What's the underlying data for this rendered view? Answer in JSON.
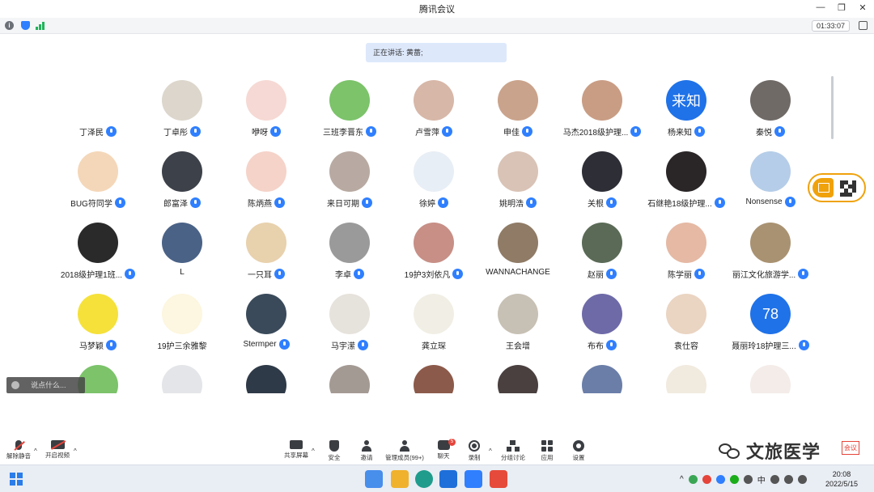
{
  "window": {
    "title": "腾讯会议",
    "timer": "01:33:07"
  },
  "speaking": {
    "label": "正在讲话: 黄蔷;"
  },
  "participants": [
    {
      "name": "丁泽民",
      "bg": "#ffffff",
      "fg": "#222222",
      "icon": "cartoon-face-avatar"
    },
    {
      "name": "丁卓彤",
      "bg": "#dcd6cc",
      "icon": "dog-avatar"
    },
    {
      "name": "咿呀",
      "bg": "#f6d9d4",
      "icon": "cartoon-girl-avatar"
    },
    {
      "name": "三班李晋东",
      "bg": "#7cc36a",
      "icon": "frog-avatar"
    },
    {
      "name": "卢雪萍",
      "bg": "#d7b7a8",
      "icon": "photo-avatar"
    },
    {
      "name": "申佳",
      "bg": "#caa38c",
      "icon": "photo-avatar"
    },
    {
      "name": "马杰2018级护理...",
      "bg": "#c99d84",
      "icon": "photo-avatar"
    },
    {
      "name": "杨来知",
      "bg": "#1f72e8",
      "text": "来知"
    },
    {
      "name": "秦悦",
      "bg": "#6f6a66",
      "icon": "photo-avatar"
    },
    {
      "name": "BUG符同学",
      "bg": "#f4d7b9",
      "icon": "anime-avatar"
    },
    {
      "name": "郎富泽",
      "bg": "#3d4149",
      "icon": "photo-avatar"
    },
    {
      "name": "陈炳燕",
      "bg": "#f5d3c9",
      "icon": "cartoon-avatar"
    },
    {
      "name": "来日可期",
      "bg": "#b8aaa2",
      "icon": "photo-avatar"
    },
    {
      "name": "徐婷",
      "bg": "#e8eef5",
      "icon": "balloon-avatar"
    },
    {
      "name": "姚明浩",
      "bg": "#d9c3b6",
      "icon": "photo-avatar"
    },
    {
      "name": "关根",
      "bg": "#2d2e36",
      "icon": "photo-avatar"
    },
    {
      "name": "石继艳18级护理...",
      "bg": "#2a2526",
      "icon": "photo-avatar"
    },
    {
      "name": "Nonsense",
      "bg": "#b5cde8",
      "icon": "anime-avatar"
    },
    {
      "name": "2018级护理1班...",
      "bg": "#2a2a2a",
      "icon": "photo-avatar"
    },
    {
      "name": "L",
      "bg": "#4a6286",
      "icon": "photo-avatar",
      "nomic": true
    },
    {
      "name": "一只耳",
      "bg": "#e8d1ad",
      "icon": "dog-avatar"
    },
    {
      "name": "李卓",
      "bg": "#9a9a9a",
      "icon": "photo-avatar"
    },
    {
      "name": "19护3刘依凡",
      "bg": "#c78f86",
      "icon": "photo-avatar"
    },
    {
      "name": "WANNACHANGE",
      "bg": "#8f7b66",
      "icon": "photo-avatar",
      "nomic": true
    },
    {
      "name": "赵丽",
      "bg": "#5a6a56",
      "icon": "photo-avatar"
    },
    {
      "name": "陈学丽",
      "bg": "#e5b9a4",
      "icon": "photo-avatar"
    },
    {
      "name": "丽江文化旅游学...",
      "bg": "#a99272",
      "icon": "photo-avatar"
    },
    {
      "name": "马梦颖",
      "bg": "#f5e13a",
      "icon": "spongebob-avatar"
    },
    {
      "name": "19护三余雅黎",
      "bg": "#fdf6e0",
      "icon": "cartoon-avatar",
      "nomic": true
    },
    {
      "name": "Stermper",
      "bg": "#3a4a5a",
      "icon": "anime-avatar"
    },
    {
      "name": "马宇潆",
      "bg": "#e6e2dc",
      "icon": "silhouette-avatar"
    },
    {
      "name": "龚立琛",
      "bg": "#f1efe5",
      "icon": "anime-avatar",
      "nomic": true
    },
    {
      "name": "王会增",
      "bg": "#c7c0b4",
      "icon": "cat-avatar",
      "nomic": true
    },
    {
      "name": "布布",
      "bg": "#6e6aa8",
      "icon": "anime-avatar"
    },
    {
      "name": "袁仕容",
      "bg": "#ead4c2",
      "icon": "cartoon-avatar",
      "nomic": true
    },
    {
      "name": "聂丽玲18护理三...",
      "bg": "#1f72e8",
      "text": "78"
    },
    {
      "name": "",
      "bg": "#7cc36a",
      "icon": "frog-avatar",
      "nomic": true
    },
    {
      "name": "",
      "bg": "#e3e5e8",
      "icon": "default-user-avatar",
      "nomic": true
    },
    {
      "name": "",
      "bg": "#2f3a48",
      "icon": "photo-avatar",
      "nomic": true
    },
    {
      "name": "",
      "bg": "#a49a94",
      "icon": "photo-avatar",
      "nomic": true
    },
    {
      "name": "",
      "bg": "#8c5a4a",
      "icon": "photo-avatar",
      "nomic": true
    },
    {
      "name": "",
      "bg": "#4a4040",
      "icon": "photo-avatar",
      "nomic": true
    },
    {
      "name": "",
      "bg": "#6a7ea8",
      "icon": "photo-avatar",
      "nomic": true
    },
    {
      "name": "",
      "bg": "#f1eadf",
      "icon": "cartoon-avatar",
      "nomic": true
    },
    {
      "name": "",
      "bg": "#f3ece8",
      "icon": "anime-avatar",
      "nomic": true
    }
  ],
  "chat": {
    "placeholder": "说点什么..."
  },
  "toolbar": {
    "unmute": "解除静音",
    "start_video": "开启视频",
    "share": "共享屏幕",
    "security": "安全",
    "invite": "邀请",
    "members": "管理成员(99+)",
    "chat": "聊天",
    "chat_badge": "5",
    "record": "录制",
    "breakout": "分组讨论",
    "apps": "应用",
    "settings": "设置"
  },
  "watermark": {
    "text": "文旅医学",
    "tag": "会议"
  },
  "taskbar": {
    "time": "20:08",
    "date": "2022/5/15",
    "ime": "中"
  },
  "colors": {
    "accent": "#2f7fff",
    "qr_border": "#f0a20b",
    "muted_red": "#e5443a"
  }
}
